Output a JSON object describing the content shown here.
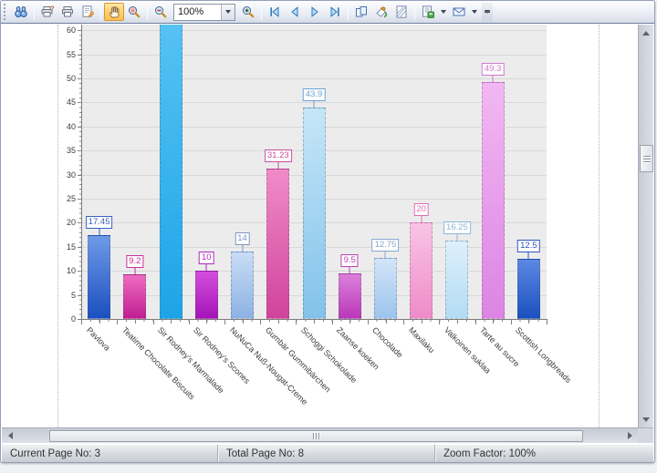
{
  "toolbar": {
    "zoom_combo": {
      "value": "100%"
    },
    "icons": [
      "binoculars-icon",
      "printer-question-icon",
      "printer-icon",
      "page-setup-wrench-icon",
      "hand-icon",
      "magnifier-icon",
      "magnifier-minus-icon",
      "magnifier-plus-icon",
      "first-page-icon",
      "previous-page-icon",
      "next-page-icon",
      "last-page-icon",
      "multiple-pages-icon",
      "paint-bucket-icon",
      "watermark-icon",
      "export-document-icon",
      "envelope-icon"
    ],
    "active_tool": "hand-tool"
  },
  "chart_data": {
    "type": "bar",
    "title": "",
    "xlabel": "",
    "ylabel": "",
    "categories": [
      "Pavlova",
      "Teatime Chocolate Biscuits",
      "Sir Rodney's Marmalade",
      "Sir Rodney's Scones",
      "NuNuCa Nuß-Nougat-Creme",
      "Gumbär Gummibärchen",
      "Schoggi Schokolade",
      "Zaanse koeken",
      "Chocolade",
      "Maxilaku",
      "Valkoinen suklaa",
      "Tarte au sucre",
      "Scottish Longbreads"
    ],
    "values": [
      17.45,
      9.2,
      null,
      10,
      14,
      31.23,
      43.9,
      9.5,
      12.75,
      20,
      16.25,
      49.3,
      12.5
    ],
    "value_labels": [
      "17.45",
      "9.2",
      null,
      "10",
      "14",
      "31.23",
      "43.9",
      "9.5",
      "12.75",
      "20",
      "16.25",
      "49.3",
      "12.5"
    ],
    "clipped_bar_index": 2,
    "ylim": [
      0,
      60
    ],
    "ytick_step": 5,
    "grid": true,
    "legend": "none",
    "plot_bg": "#ececec",
    "grid_color": "#d9d9d9",
    "bar_styles": [
      {
        "top": "#6f9ae8",
        "bottom": "#1c4fc0",
        "label": "#3a60c4"
      },
      {
        "top": "#ee6cc0",
        "bottom": "#c01e92",
        "label": "#c8309c"
      },
      {
        "top": "#55c2f2",
        "bottom": "#1da4e8",
        "label": "#1da4e8"
      },
      {
        "top": "#d44fdc",
        "bottom": "#a414b8",
        "label": "#ae28c0"
      },
      {
        "top": "#c9dcf6",
        "bottom": "#8cb2e4",
        "label": "#7c96c4"
      },
      {
        "top": "#f08cc8",
        "bottom": "#d0439c",
        "label": "#ca4f9e"
      },
      {
        "top": "#c6e6f8",
        "bottom": "#82c2ea",
        "label": "#6aa4d4"
      },
      {
        "top": "#da80da",
        "bottom": "#ba38ba",
        "label": "#bc44b4"
      },
      {
        "top": "#d3e4f8",
        "bottom": "#9cc4ee",
        "label": "#86a6ce"
      },
      {
        "top": "#f9c4e6",
        "bottom": "#ee8cc8",
        "label": "#e070b2"
      },
      {
        "top": "#def0fb",
        "bottom": "#b2dbf4",
        "label": "#8fb6d6"
      },
      {
        "top": "#f2b8f2",
        "bottom": "#dc84e4",
        "label": "#cc7ace"
      },
      {
        "top": "#5c88e2",
        "bottom": "#1c50c0",
        "label": "#2c56c0"
      }
    ]
  },
  "status_bar": {
    "current_page": "Current Page No: 3",
    "total_pages": "Total Page No: 8",
    "zoom_factor": "Zoom Factor: 100%"
  }
}
